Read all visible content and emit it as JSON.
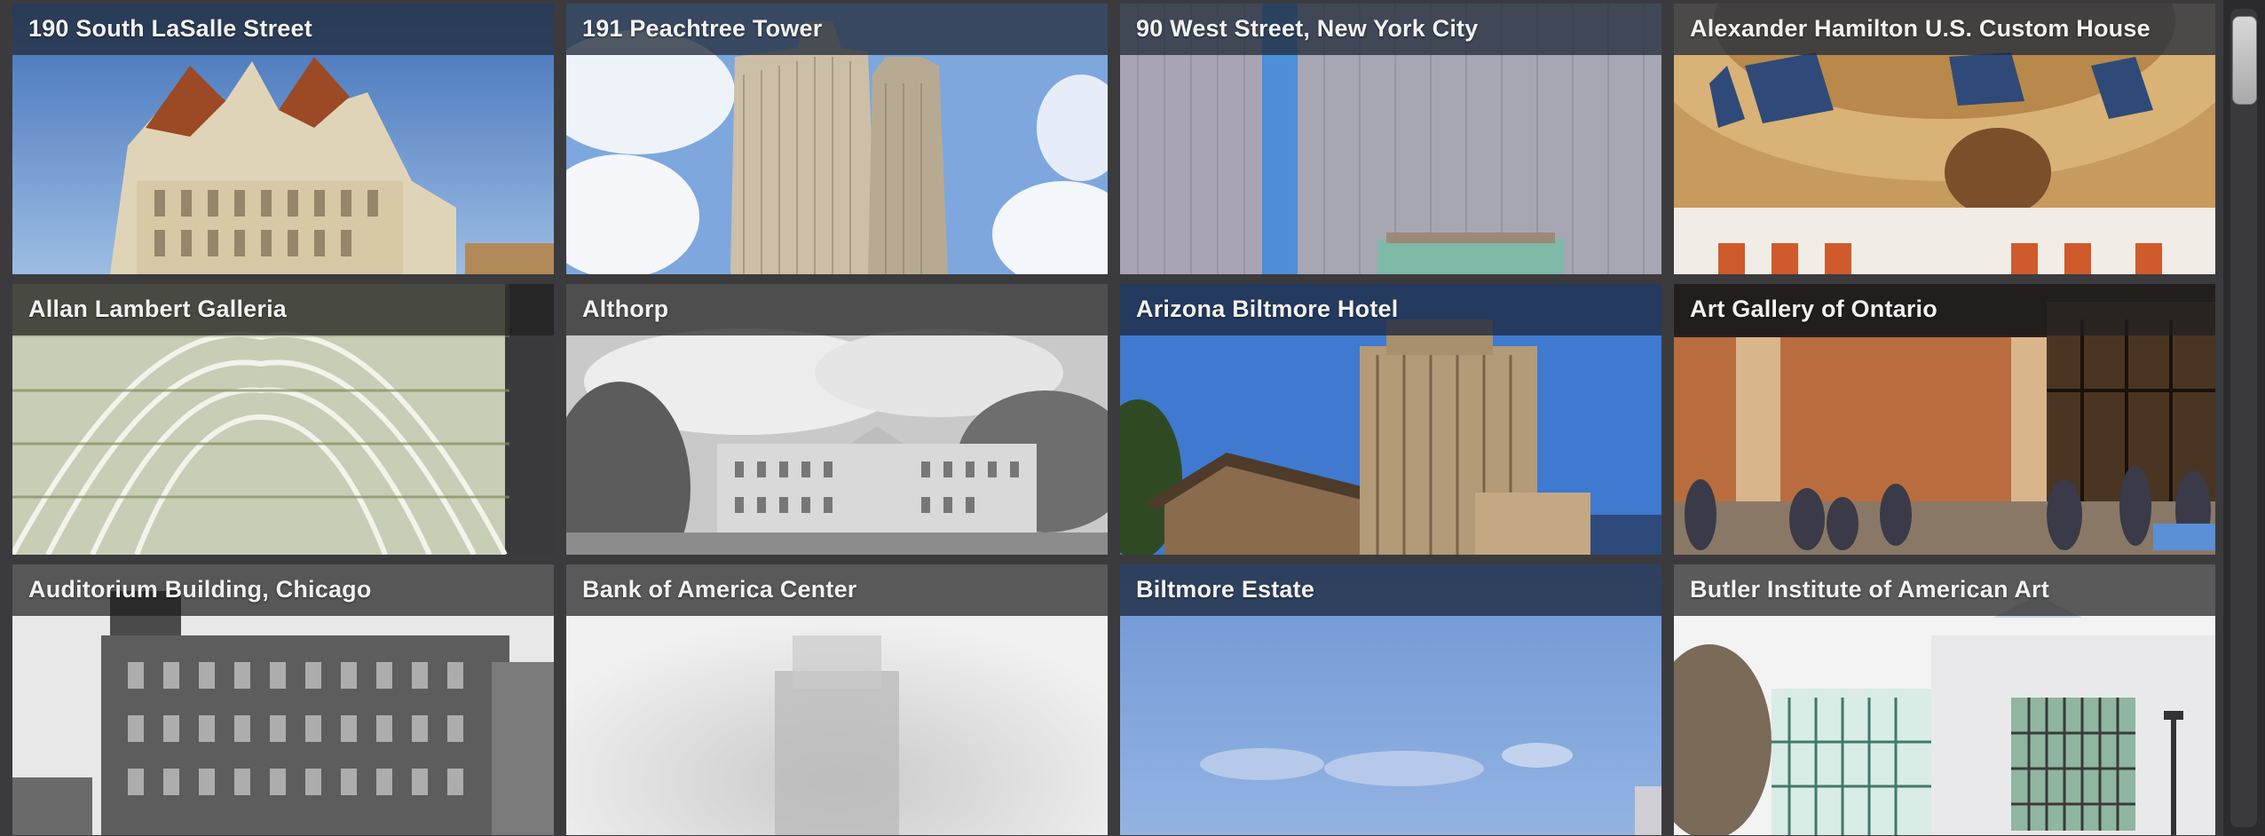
{
  "gallery": {
    "tiles": [
      {
        "title": "190 South LaSalle Street"
      },
      {
        "title": "191 Peachtree Tower"
      },
      {
        "title": "90 West Street, New York City"
      },
      {
        "title": "Alexander Hamilton U.S. Custom House"
      },
      {
        "title": "Allan Lambert Galleria"
      },
      {
        "title": "Althorp"
      },
      {
        "title": "Arizona Biltmore Hotel"
      },
      {
        "title": "Art Gallery of Ontario"
      },
      {
        "title": "Auditorium Building, Chicago"
      },
      {
        "title": "Bank of America Center"
      },
      {
        "title": "Biltmore Estate"
      },
      {
        "title": "Butler Institute of American Art"
      }
    ]
  },
  "colors": {
    "background": "#3b3b3e",
    "title_bar": "#232d3c",
    "title_text": "#f2f2f2"
  }
}
